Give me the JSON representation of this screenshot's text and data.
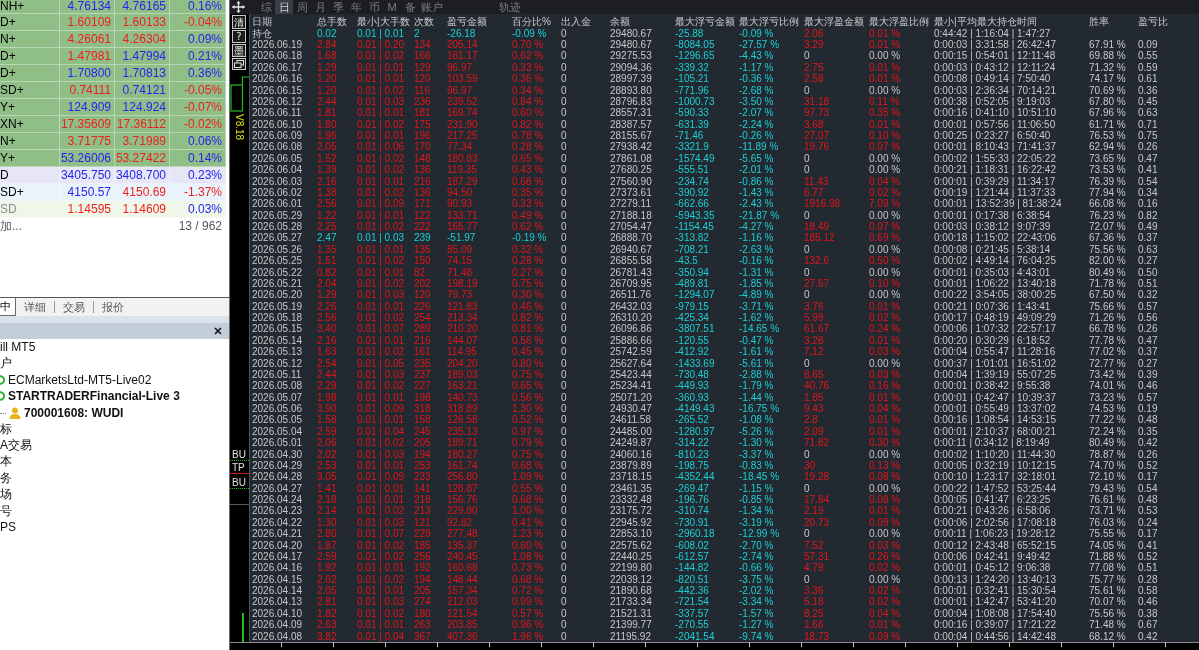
{
  "market_watch": {
    "rows": [
      {
        "symbol": "NH+",
        "bid": "4.76134",
        "ask": "4.76165",
        "change": "0.16%",
        "bid_up": true,
        "ask_up": true,
        "change_up": true,
        "color": "#8fbe87",
        "disabled": false
      },
      {
        "symbol": "D+",
        "bid": "1.60109",
        "ask": "1.60133",
        "change": "-0.04%",
        "bid_up": false,
        "ask_up": false,
        "change_up": false,
        "color": "#8fbe87",
        "disabled": false
      },
      {
        "symbol": "N+",
        "bid": "4.26061",
        "ask": "4.26304",
        "change": "0.09%",
        "bid_up": false,
        "ask_up": false,
        "change_up": true,
        "color": "#8fbe87",
        "disabled": false
      },
      {
        "symbol": "D+",
        "bid": "1.47981",
        "ask": "1.47994",
        "change": "0.21%",
        "bid_up": false,
        "ask_up": true,
        "change_up": true,
        "color": "#8fbe87",
        "disabled": false
      },
      {
        "symbol": "D+",
        "bid": "1.70800",
        "ask": "1.70813",
        "change": "0.36%",
        "bid_up": true,
        "ask_up": true,
        "change_up": true,
        "color": "#8fbe87",
        "disabled": false
      },
      {
        "symbol": "SD+",
        "bid": "0.74111",
        "ask": "0.74121",
        "change": "-0.05%",
        "bid_up": false,
        "ask_up": true,
        "change_up": false,
        "color": "#8fbe87",
        "disabled": false
      },
      {
        "symbol": "Y+",
        "bid": "124.909",
        "ask": "124.924",
        "change": "-0.07%",
        "bid_up": true,
        "ask_up": true,
        "change_up": false,
        "color": "#8fbe87",
        "disabled": false
      },
      {
        "symbol": "XN+",
        "bid": "17.35609",
        "ask": "17.36112",
        "change": "-0.02%",
        "bid_up": false,
        "ask_up": false,
        "change_up": false,
        "color": "#8fbe87",
        "disabled": false
      },
      {
        "symbol": "N+",
        "bid": "3.71775",
        "ask": "3.71989",
        "change": "0.06%",
        "bid_up": false,
        "ask_up": false,
        "change_up": true,
        "color": "#8fbe87",
        "disabled": false
      },
      {
        "symbol": "Y+",
        "bid": "53.26006",
        "ask": "53.27422",
        "change": "0.14%",
        "bid_up": true,
        "ask_up": false,
        "change_up": true,
        "color": "#8fbe87",
        "disabled": false
      },
      {
        "symbol": "D",
        "bid": "3405.750",
        "ask": "3408.700",
        "change": "0.23%",
        "bid_up": true,
        "ask_up": true,
        "change_up": true,
        "color": "#e6e6f7",
        "disabled": false
      },
      {
        "symbol": "SD+",
        "bid": "4150.57",
        "ask": "4150.69",
        "change": "-1.37%",
        "bid_up": true,
        "ask_up": false,
        "change_up": false,
        "color": "#e9f3fb",
        "disabled": false
      },
      {
        "symbol": "SD",
        "bid": "1.14595",
        "ask": "1.14609",
        "change": "0.03%",
        "bid_up": false,
        "ask_up": false,
        "change_up": true,
        "color": "#eef7e8",
        "disabled": true
      }
    ],
    "add_hint": "加...",
    "count": "13 / 962"
  },
  "panel_tabs": [
    {
      "label": "中",
      "selected": true
    },
    {
      "label": "详细",
      "selected": false
    },
    {
      "label": "交易",
      "selected": false
    },
    {
      "label": "报价",
      "selected": false
    }
  ],
  "navigator": {
    "items": [
      {
        "label": "ill MT5",
        "active": false
      },
      {
        "label": "户",
        "active": false,
        "children": [
          {
            "label": "ECMarketsLtd-MT5-Live02",
            "kind": "server",
            "active": false
          },
          {
            "label": "STARTRADERFinancial-Live 3",
            "kind": "server",
            "active": true,
            "children": [
              {
                "label": "700001608: WUDI",
                "kind": "account",
                "active": true
              }
            ]
          }
        ]
      },
      {
        "label": "标",
        "active": false
      },
      {
        "label": "A交易",
        "active": false
      },
      {
        "label": "本",
        "active": false
      },
      {
        "label": "务",
        "active": false
      },
      {
        "label": "场",
        "active": false
      },
      {
        "label": "号",
        "active": false
      },
      {
        "label": "PS",
        "active": false
      }
    ]
  },
  "period_tabs": [
    {
      "label": "综",
      "selected": false
    },
    {
      "label": "日",
      "selected": true
    },
    {
      "label": "周",
      "selected": false
    },
    {
      "label": "月",
      "selected": false
    },
    {
      "label": "季",
      "selected": false
    },
    {
      "label": "年",
      "selected": false
    },
    {
      "label": "币",
      "selected": false
    },
    {
      "label": "M",
      "selected": false
    },
    {
      "label": "备",
      "selected": false
    },
    {
      "label": "账户",
      "selected": false
    }
  ],
  "track_label": "轨迹",
  "chart": {
    "buttons": [
      "清",
      "?",
      "墨"
    ],
    "version": "V8.18",
    "price_labels": [
      {
        "text": "BU",
        "kind": "buy"
      },
      {
        "text": "TP",
        "kind": "take_profit"
      },
      {
        "text": "BU",
        "kind": "buy"
      }
    ]
  },
  "table": {
    "columns": [
      "日期",
      "总手数",
      "最小|大手数",
      "次数",
      "盈亏金额",
      "百分比%",
      "出入金",
      "余额",
      "最大浮亏金额",
      "最大浮亏比例",
      "最大浮盈金额",
      "最大浮盈比例",
      "最小|平均最大持仓时间",
      "胜率",
      "盈亏比"
    ],
    "rows": [
      {
        "loss": true,
        "float_profit": true,
        "cells": [
          "持仓",
          "0.02",
          "0.01 | 0.01",
          "2",
          "-26.18",
          "-0.09 %",
          "0",
          "29480.67",
          "-25.88",
          "-0.09 %",
          "2.06",
          "0.01 %",
          "0:44:42 | 1:16:04 | 1:47:27"
        ]
      },
      {
        "loss": false,
        "float_profit": true,
        "cells": [
          "2026.06.19",
          "2.84",
          "0.01 | 0.20",
          "134",
          "205.14",
          "0.70 %",
          "0",
          "29480.67",
          "-8084.05",
          "-27.57 %",
          "3.29",
          "0.01 %",
          "0:00:03 | 3:31:58 | 26:42:47",
          "67.91 %",
          "0.09"
        ]
      },
      {
        "loss": false,
        "float_profit": false,
        "cells": [
          "2026.06.18",
          "1.68",
          "0.01 | 0.02",
          "166",
          "181.17",
          "0.62 %",
          "0",
          "29275.53",
          "-1296.65",
          "-4.43 %",
          "0",
          "0.00 %",
          "0:00:15 | 0:54:01 | 12:11:48",
          "69.88 %",
          "0.55"
        ]
      },
      {
        "loss": false,
        "float_profit": true,
        "cells": [
          "2026.06.17",
          "1.29",
          "0.01 | 0.01",
          "129",
          "96.97",
          "0.33 %",
          "0",
          "29094.36",
          "-339.32",
          "-1.17 %",
          "2.75",
          "0.01 %",
          "0:00:03 | 0:43:12 | 12:11:24",
          "71.32 %",
          "0.59"
        ]
      },
      {
        "loss": false,
        "float_profit": true,
        "cells": [
          "2026.06.16",
          "1.20",
          "0.01 | 0.01",
          "120",
          "103.59",
          "0.36 %",
          "0",
          "28997.39",
          "-105.21",
          "-0.36 %",
          "2.58",
          "0.01 %",
          "0:00:08 | 0:49:14 | 7:50:40",
          "74.17 %",
          "0.61"
        ]
      },
      {
        "loss": false,
        "float_profit": false,
        "cells": [
          "2026.06.15",
          "1.20",
          "0.01 | 0.02",
          "116",
          "96.97",
          "0.34 %",
          "0",
          "28893.80",
          "-771.96",
          "-2.68 %",
          "0",
          "0.00 %",
          "0:00:03 | 2:36:34 | 70:14:21",
          "70.69 %",
          "0.36"
        ]
      },
      {
        "loss": false,
        "float_profit": true,
        "cells": [
          "2026.06.12",
          "2.44",
          "0.01 | 0.03",
          "236",
          "239.52",
          "0.84 %",
          "0",
          "28796.83",
          "-1000.73",
          "-3.50 %",
          "31.18",
          "0.11 %",
          "0:00:38 | 0:52:05 | 9:19:03",
          "67.80 %",
          "0.45"
        ]
      },
      {
        "loss": false,
        "float_profit": true,
        "cells": [
          "2026.06.11",
          "1.81",
          "0.01 | 0.01",
          "181",
          "169.74",
          "0.60 %",
          "0",
          "28557.31",
          "-590.33",
          "-2.07 %",
          "97.73",
          "0.35 %",
          "0:00:16 | 0:41:10 | 10:51:10",
          "67.96 %",
          "0.63"
        ]
      },
      {
        "loss": false,
        "float_profit": true,
        "cells": [
          "2026.06.10",
          "1.80",
          "0.01 | 0.02",
          "175",
          "231.90",
          "0.82 %",
          "0",
          "28387.57",
          "-631.39",
          "-2.24 %",
          "3.68",
          "0.01 %",
          "0:00:01 | 0:57:56 | 11:06:50",
          "61.71 %",
          "0.71"
        ]
      },
      {
        "loss": false,
        "float_profit": true,
        "cells": [
          "2026.06.09",
          "1.96",
          "0.01 | 0.01",
          "196",
          "217.25",
          "0.78 %",
          "0",
          "28155.67",
          "-71.46",
          "-0.26 %",
          "27.07",
          "0.10 %",
          "0:00:25 | 0:23:27 | 6:50:40",
          "76.53 %",
          "0.75"
        ]
      },
      {
        "loss": false,
        "float_profit": true,
        "cells": [
          "2026.06.08",
          "2.05",
          "0.01 | 0.06",
          "170",
          "77.34",
          "0.28 %",
          "0",
          "27938.42",
          "-3321.9",
          "-11.89 %",
          "19.76",
          "0.07 %",
          "0:00:01 | 8:10:43 | 71:41:37",
          "62.94 %",
          "0.26"
        ]
      },
      {
        "loss": false,
        "float_profit": false,
        "cells": [
          "2026.06.05",
          "1.52",
          "0.01 | 0.02",
          "148",
          "180.83",
          "0.65 %",
          "0",
          "27861.08",
          "-1574.49",
          "-5.65 %",
          "0",
          "0.00 %",
          "0:00:02 | 1:55:33 | 22:05:22",
          "73.65 %",
          "0.47"
        ]
      },
      {
        "loss": false,
        "float_profit": false,
        "cells": [
          "2026.06.04",
          "1.39",
          "0.01 | 0.02",
          "136",
          "119.35",
          "0.43 %",
          "0",
          "27680.25",
          "-555.51",
          "-2.01 %",
          "0",
          "0.00 %",
          "0:00:21 | 1:18:31 | 16:22:42",
          "73.53 %",
          "0.41"
        ]
      },
      {
        "loss": false,
        "float_profit": true,
        "cells": [
          "2026.06.03",
          "2.16",
          "0.01 | 0.01",
          "216",
          "187.29",
          "0.68 %",
          "0",
          "27560.90",
          "-234.74",
          "-0.86 %",
          "11.43",
          "0.04 %",
          "0:00:01 | 0:39:29 | 11:34:17",
          "76.39 %",
          "0.54"
        ]
      },
      {
        "loss": false,
        "float_profit": true,
        "cells": [
          "2026.06.02",
          "1.38",
          "0.01 | 0.02",
          "136",
          "94.50",
          "0.35 %",
          "0",
          "27373.61",
          "-390.92",
          "-1.43 %",
          "6.77",
          "0.02 %",
          "0:00:19 | 1:21:44 | 11:37:33",
          "77.94 %",
          "0.34"
        ]
      },
      {
        "loss": false,
        "float_profit": true,
        "cells": [
          "2026.06.01",
          "2.56",
          "0.01 | 0.09",
          "171",
          "90.93",
          "0.33 %",
          "0",
          "27279.11",
          "-662.66",
          "-2.43 %",
          "1916.98",
          "7.09 %",
          "0:00:01 | 13:52:39 | 81:38:24",
          "66.08 %",
          "0.16"
        ]
      },
      {
        "loss": false,
        "float_profit": false,
        "cells": [
          "2026.05.29",
          "1.22",
          "0.01 | 0.01",
          "122",
          "133.71",
          "0.49 %",
          "0",
          "27188.18",
          "-5943.35",
          "-21.87 %",
          "0",
          "0.00 %",
          "0:00:01 | 0:17:38 | 6:38:54",
          "76.23 %",
          "0.82"
        ]
      },
      {
        "loss": false,
        "float_profit": true,
        "cells": [
          "2026.05.28",
          "2.25",
          "0.01 | 0.02",
          "222",
          "165.77",
          "0.62 %",
          "0",
          "27054.47",
          "-1154.45",
          "-4.27 %",
          "18.49",
          "0.07 %",
          "0:00:03 | 0:38:12 | 9:07:39",
          "72.07 %",
          "0.49"
        ]
      },
      {
        "loss": true,
        "float_profit": true,
        "cells": [
          "2026.05.27",
          "2.47",
          "0.01 | 0.03",
          "239",
          "-51.97",
          "-0.19 %",
          "0",
          "26888.70",
          "-313.82",
          "-1.16 %",
          "185.12",
          "0.69 %",
          "0:00:18 | 1:15:02 | 22:43:06",
          "67.36 %",
          "0.37"
        ]
      },
      {
        "loss": false,
        "float_profit": false,
        "cells": [
          "2026.05.26",
          "1.35",
          "0.01 | 0.01",
          "135",
          "85.09",
          "0.32 %",
          "0",
          "26940.67",
          "-708.21",
          "-2.63 %",
          "0",
          "0.00 %",
          "0:00:08 | 0:21:45 | 5:38:14",
          "75.56 %",
          "0.63"
        ]
      },
      {
        "loss": false,
        "float_profit": true,
        "cells": [
          "2026.05.25",
          "1.51",
          "0.01 | 0.02",
          "150",
          "74.15",
          "0.28 %",
          "0",
          "26855.58",
          "-43.5",
          "-0.16 %",
          "132.6",
          "0.50 %",
          "0:00:02 | 4:49:14 | 76:04:25",
          "82.00 %",
          "0.27"
        ]
      },
      {
        "loss": false,
        "float_profit": false,
        "cells": [
          "2026.05.22",
          "0.82",
          "0.01 | 0.01",
          "82",
          "71.48",
          "0.27 %",
          "0",
          "26781.43",
          "-350.94",
          "-1.31 %",
          "0",
          "0.00 %",
          "0:00:01 | 0:35:03 | 4:43:01",
          "80.49 %",
          "0.50"
        ]
      },
      {
        "loss": false,
        "float_profit": true,
        "cells": [
          "2026.05.21",
          "2.04",
          "0.01 | 0.02",
          "202",
          "198.19",
          "0.75 %",
          "0",
          "26709.95",
          "-489.81",
          "-1.85 %",
          "27.67",
          "0.10 %",
          "0:00:01 | 1:06:22 | 13:40:18",
          "71.78 %",
          "0.51"
        ]
      },
      {
        "loss": false,
        "float_profit": false,
        "cells": [
          "2026.05.20",
          "1.29",
          "0.01 | 0.03",
          "120",
          "79.73",
          "0.30 %",
          "0",
          "26511.76",
          "-1294.07",
          "-4.89 %",
          "0",
          "0.00 %",
          "0:00:22 | 3:54:05 | 38:00:25",
          "67.50 %",
          "0.32"
        ]
      },
      {
        "loss": false,
        "float_profit": true,
        "cells": [
          "2026.05.19",
          "2.26",
          "0.01 | 0.01",
          "226",
          "121.83",
          "0.46 %",
          "0",
          "26432.03",
          "-979.15",
          "-3.71 %",
          "3.76",
          "0.01 %",
          "0:00:21 | 0:07:36 | 1:43:41",
          "75.66 %",
          "0.57"
        ]
      },
      {
        "loss": false,
        "float_profit": true,
        "cells": [
          "2026.05.18",
          "2.56",
          "0.01 | 0.02",
          "254",
          "213.34",
          "0.82 %",
          "0",
          "26310.20",
          "-425.34",
          "-1.62 %",
          "5.99",
          "0.02 %",
          "0:00:17 | 0:48:19 | 49:09:29",
          "71.26 %",
          "0.56"
        ]
      },
      {
        "loss": false,
        "float_profit": true,
        "cells": [
          "2026.05.15",
          "3.40",
          "0.01 | 0.07",
          "289",
          "210.20",
          "0.81 %",
          "0",
          "26096.86",
          "-3807.51",
          "-14.65 %",
          "61.67",
          "0.24 %",
          "0:00:06 | 1:07:32 | 22:57:17",
          "66.78 %",
          "0.26"
        ]
      },
      {
        "loss": false,
        "float_profit": true,
        "cells": [
          "2026.05.14",
          "2.16",
          "0.01 | 0.01",
          "216",
          "144.07",
          "0.56 %",
          "0",
          "25886.66",
          "-120.55",
          "-0.47 %",
          "3.28",
          "0.01 %",
          "0:00:20 | 0:30:29 | 6:18:52",
          "77.78 %",
          "0.47"
        ]
      },
      {
        "loss": false,
        "float_profit": true,
        "cells": [
          "2026.05.13",
          "1.63",
          "0.01 | 0.02",
          "161",
          "114.95",
          "0.45 %",
          "0",
          "25742.59",
          "-412.92",
          "-1.61 %",
          "7.12",
          "0.03 %",
          "0:00:04 | 0:55:47 | 11:28:16",
          "77.02 %",
          "0.37"
        ]
      },
      {
        "loss": false,
        "float_profit": false,
        "cells": [
          "2026.05.12",
          "2.54",
          "0.01 | 0.05",
          "235",
          "204.20",
          "0.80 %",
          "0",
          "25627.64",
          "-1433.69",
          "-5.61 %",
          "0",
          "0.00 %",
          "0:00:37 | 1:01:01 | 16:51:02",
          "72.77 %",
          "0.27"
        ]
      },
      {
        "loss": false,
        "float_profit": true,
        "cells": [
          "2026.05.11",
          "2.44",
          "0.01 | 0.03",
          "237",
          "189.03",
          "0.75 %",
          "0",
          "25423.44",
          "-730.48",
          "-2.88 %",
          "8.65",
          "0.03 %",
          "0:00:04 | 1:39:19 | 55:07:25",
          "73.42 %",
          "0.39"
        ]
      },
      {
        "loss": false,
        "float_profit": true,
        "cells": [
          "2026.05.08",
          "2.29",
          "0.01 | 0.02",
          "227",
          "163.21",
          "0.65 %",
          "0",
          "25234.41",
          "-449.93",
          "-1.79 %",
          "40.76",
          "0.16 %",
          "0:00:01 | 0:38:42 | 9:55:38",
          "74.01 %",
          "0.46"
        ]
      },
      {
        "loss": false,
        "float_profit": true,
        "cells": [
          "2026.05.07",
          "1.98",
          "0.01 | 0.01",
          "198",
          "140.73",
          "0.56 %",
          "0",
          "25071.20",
          "-360.93",
          "-1.44 %",
          "1.85",
          "0.01 %",
          "0:00:01 | 0:42:47 | 10:39:37",
          "73.23 %",
          "0.57"
        ]
      },
      {
        "loss": false,
        "float_profit": true,
        "cells": [
          "2026.05.06",
          "3.90",
          "0.01 | 0.09",
          "318",
          "318.89",
          "1.30 %",
          "0",
          "24930.47",
          "-4149.43",
          "-16.75 %",
          "9.43",
          "0.04 %",
          "0:00:01 | 0:55:49 | 13:37:02",
          "74.53 %",
          "0.19"
        ]
      },
      {
        "loss": false,
        "float_profit": true,
        "cells": [
          "2026.05.05",
          "1.58",
          "0.01 | 0.01",
          "158",
          "126.58",
          "0.52 %",
          "0",
          "24611.58",
          "-265.52",
          "-1.08 %",
          "2.8",
          "0.01 %",
          "0:00:16 | 1:08:54 | 14:53:15",
          "77.22 %",
          "0.48"
        ]
      },
      {
        "loss": false,
        "float_profit": true,
        "cells": [
          "2026.05.04",
          "2.59",
          "0.01 | 0.04",
          "245",
          "235.13",
          "0.97 %",
          "0",
          "24485.00",
          "-1280.97",
          "-5.26 %",
          "2.09",
          "0.01 %",
          "0:00:01 | 2:10:37 | 68:00:21",
          "72.24 %",
          "0.35"
        ]
      },
      {
        "loss": false,
        "float_profit": true,
        "cells": [
          "2026.05.01",
          "2.06",
          "0.01 | 0.02",
          "205",
          "189.71",
          "0.79 %",
          "0",
          "24249.87",
          "-314.22",
          "-1.30 %",
          "71.82",
          "0.30 %",
          "0:00:11 | 0:34:12 | 8:19:49",
          "80.49 %",
          "0.42"
        ]
      },
      {
        "loss": false,
        "float_profit": false,
        "cells": [
          "2026.04.30",
          "2.02",
          "0.01 | 0.03",
          "194",
          "180.27",
          "0.75 %",
          "0",
          "24060.16",
          "-810.23",
          "-3.37 %",
          "0",
          "0.00 %",
          "0:00:02 | 1:10:20 | 11:44:30",
          "78.87 %",
          "0.26"
        ]
      },
      {
        "loss": false,
        "float_profit": true,
        "cells": [
          "2026.04.29",
          "2.53",
          "0.01 | 0.01",
          "253",
          "161.74",
          "0.68 %",
          "0",
          "23879.89",
          "-198.75",
          "-0.83 %",
          "30",
          "0.13 %",
          "0:00:05 | 0:32:19 | 10:12:15",
          "74.70 %",
          "0.52"
        ]
      },
      {
        "loss": false,
        "float_profit": true,
        "cells": [
          "2026.04.28",
          "3.05",
          "0.01 | 0.09",
          "233",
          "256.80",
          "1.09 %",
          "0",
          "23718.15",
          "-4352.44",
          "-18.45 %",
          "19.28",
          "0.08 %",
          "0:00:10 | 1:23:17 | 32:18:01",
          "72.10 %",
          "0.17"
        ]
      },
      {
        "loss": false,
        "float_profit": false,
        "cells": [
          "2026.04.27",
          "1.41",
          "0.01 | 0.01",
          "141",
          "128.87",
          "0.55 %",
          "0",
          "23461.35",
          "-269.47",
          "-1.15 %",
          "0",
          "0.00 %",
          "0:00:22 | 1:47:52 | 53:25:44",
          "79.43 %",
          "0.54"
        ]
      },
      {
        "loss": false,
        "float_profit": true,
        "cells": [
          "2026.04.24",
          "2.18",
          "0.01 | 0.01",
          "218",
          "156.76",
          "0.68 %",
          "0",
          "23332.48",
          "-196.76",
          "-0.85 %",
          "17.84",
          "0.08 %",
          "0:00:05 | 0:41:47 | 6:23:25",
          "76.61 %",
          "0.48"
        ]
      },
      {
        "loss": false,
        "float_profit": true,
        "cells": [
          "2026.04.23",
          "2.14",
          "0.01 | 0.02",
          "213",
          "229.80",
          "1.00 %",
          "0",
          "23175.72",
          "-310.74",
          "-1.34 %",
          "2.19",
          "0.01 %",
          "0:00:21 | 0:43:26 | 6:58:06",
          "73.71 %",
          "0.53"
        ]
      },
      {
        "loss": false,
        "float_profit": true,
        "cells": [
          "2026.04.22",
          "1.30",
          "0.01 | 0.03",
          "121",
          "92.82",
          "0.41 %",
          "0",
          "22945.92",
          "-730.91",
          "-3.19 %",
          "20.73",
          "0.09 %",
          "0:00:06 | 2:02:56 | 17:08:18",
          "76.03 %",
          "0.24"
        ]
      },
      {
        "loss": false,
        "float_profit": false,
        "cells": [
          "2026.04.21",
          "2.80",
          "0.01 | 0.07",
          "229",
          "277.48",
          "1.23 %",
          "0",
          "22853.10",
          "-2960.18",
          "-12.99 %",
          "0",
          "0.00 %",
          "0:00:11 | 1:06:23 | 19:28:12",
          "75.55 %",
          "0.17"
        ]
      },
      {
        "loss": false,
        "float_profit": true,
        "cells": [
          "2026.04.20",
          "1.87",
          "0.01 | 0.02",
          "185",
          "135.37",
          "0.60 %",
          "0",
          "22575.62",
          "-608.02",
          "-2.70 %",
          "7.52",
          "0.03 %",
          "0:00:12 | 2:43:48 | 65:52:15",
          "74.05 %",
          "0.41"
        ]
      },
      {
        "loss": false,
        "float_profit": true,
        "cells": [
          "2026.04.17",
          "2.59",
          "0.01 | 0.02",
          "256",
          "240.45",
          "1.08 %",
          "0",
          "22440.25",
          "-612.57",
          "-2.74 %",
          "57.31",
          "0.26 %",
          "0:00:06 | 0:42:41 | 9:49:42",
          "71.88 %",
          "0.52"
        ]
      },
      {
        "loss": false,
        "float_profit": true,
        "cells": [
          "2026.04.16",
          "1.92",
          "0.01 | 0.01",
          "192",
          "160.68",
          "0.73 %",
          "0",
          "22199.80",
          "-144.82",
          "-0.66 %",
          "4.79",
          "0.02 %",
          "0:00:01 | 0:45:12 | 9:06:38",
          "77.08 %",
          "0.51"
        ]
      },
      {
        "loss": false,
        "float_profit": false,
        "cells": [
          "2026.04.15",
          "2.02",
          "0.01 | 0.02",
          "194",
          "148.44",
          "0.68 %",
          "0",
          "22039.12",
          "-820.51",
          "-3.75 %",
          "0",
          "0.00 %",
          "0:00:13 | 1:24:20 | 13:40:13",
          "75.77 %",
          "0.28"
        ]
      },
      {
        "loss": false,
        "float_profit": true,
        "cells": [
          "2026.04.14",
          "2.05",
          "0.01 | 0.01",
          "205",
          "157.34",
          "0.72 %",
          "0",
          "21890.68",
          "-442.36",
          "-2.02 %",
          "3.36",
          "0.02 %",
          "0:00:01 | 0:32:41 | 15:30:54",
          "75.61 %",
          "0.58"
        ]
      },
      {
        "loss": false,
        "float_profit": true,
        "cells": [
          "2026.04.13",
          "2.81",
          "0.01 | 0.03",
          "274",
          "212.03",
          "0.99 %",
          "0",
          "21733.34",
          "-721.54",
          "-3.34 %",
          "5.18",
          "0.02 %",
          "0:00:01 | 1:42:47 | 53:41:20",
          "70.07 %",
          "0.46"
        ]
      },
      {
        "loss": false,
        "float_profit": true,
        "cells": [
          "2026.04.10",
          "1.82",
          "0.01 | 0.02",
          "180",
          "121.54",
          "0.57 %",
          "0",
          "21521.31",
          "-337.57",
          "-1.57 %",
          "8.25",
          "0.04 %",
          "0:00:04 | 1:08:08 | 17:54:40",
          "75.56 %",
          "0.38"
        ]
      },
      {
        "loss": false,
        "float_profit": true,
        "cells": [
          "2026.04.09",
          "2.63",
          "0.01 | 0.01",
          "263",
          "203.85",
          "0.96 %",
          "0",
          "21399.77",
          "-270.55",
          "-1.27 %",
          "1.66",
          "0.01 %",
          "0:00:16 | 0:39:07 | 17:21:22",
          "71.48 %",
          "0.67"
        ]
      },
      {
        "loss": false,
        "float_profit": true,
        "cells": [
          "2026.04.08",
          "3.82",
          "0.01 | 0.04",
          "367",
          "407.36",
          "1.96 %",
          "0",
          "21195.92",
          "-2041.54",
          "-9.74 %",
          "18.73",
          "0.09 %",
          "0:00:04 | 0:44:56 | 14:42:48",
          "68.12 %",
          "0.42"
        ]
      }
    ]
  }
}
